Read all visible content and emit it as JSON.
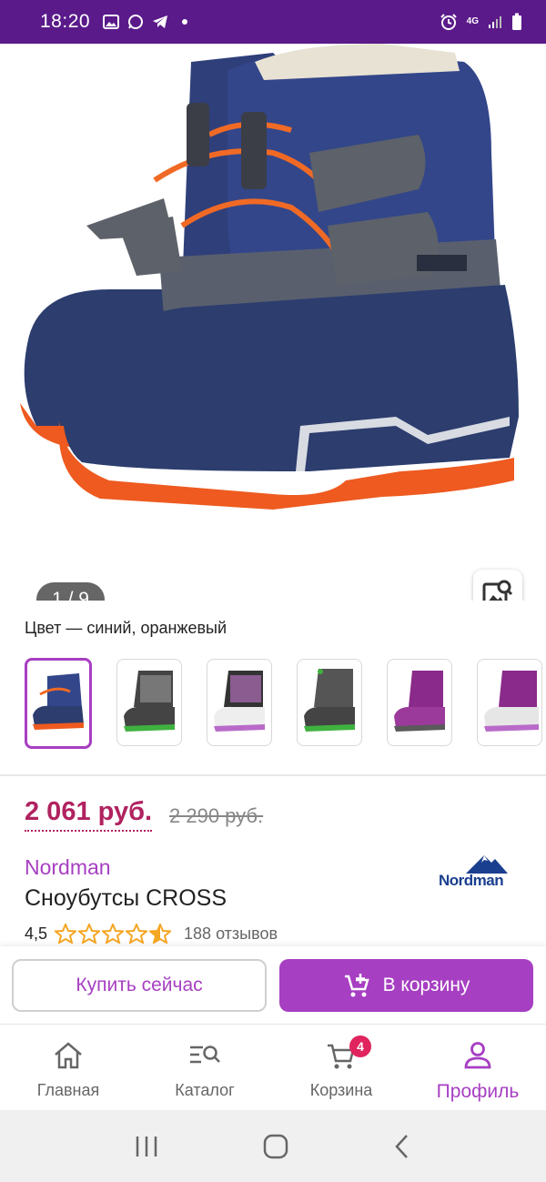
{
  "status_bar": {
    "time": "18:20",
    "network": "4G"
  },
  "gallery": {
    "counter": "1 / 9"
  },
  "colors": {
    "label": "Цвет — синий, оранжевый",
    "swatches": [
      "navy-orange",
      "grey-green-print",
      "white-purple-print",
      "grey-green",
      "purple",
      "purple-white"
    ],
    "selected_index": 0
  },
  "product": {
    "price": "2 061 руб.",
    "old_price": "2 290 руб.",
    "brand": "Nordman",
    "brand_logo_text": "Nordman",
    "title": "Сноубутсы CROSS",
    "rating": "4,5",
    "rating_stars": 4.5,
    "reviews": "188 отзывов"
  },
  "actions": {
    "buy_now": "Купить сейчас",
    "add_to_cart": "В корзину"
  },
  "nav": {
    "items": [
      {
        "label": "Главная",
        "icon": "home-icon"
      },
      {
        "label": "Каталог",
        "icon": "catalog-search-icon"
      },
      {
        "label": "Корзина",
        "icon": "cart-icon",
        "badge": "4"
      },
      {
        "label": "Профиль",
        "icon": "profile-icon"
      }
    ],
    "active_index": 3
  },
  "theme": {
    "accent": "#a73fc2",
    "status_bar": "#5a1a8a",
    "price": "#b0225f",
    "star": "#f5a623"
  }
}
